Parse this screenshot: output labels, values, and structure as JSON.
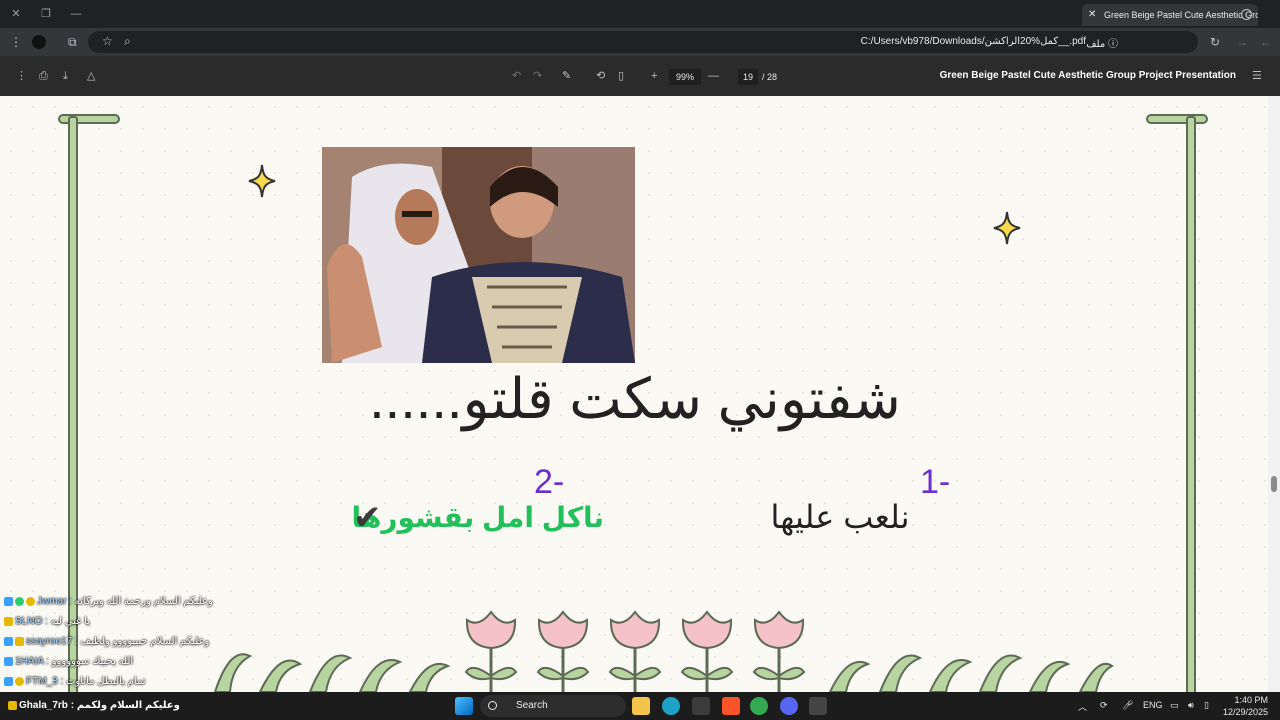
{
  "browser": {
    "tab_title": "Green Beige Pastel Cute Aesthetic Group Project Presentation",
    "url": "C:/Users/vb978/Downloads/كمل%20الراكشن__.pdf",
    "url_chip": "ملف"
  },
  "pdf_toolbar": {
    "zoom": "99%",
    "current_page": "19",
    "total_pages": "/ 28",
    "document_title": "Green Beige Pastel Cute Aesthetic Group Project Presentation"
  },
  "slide": {
    "heading": "شفتوني سكت قلتو......",
    "option1_number": "1-",
    "option1_text": "نلعب عليها",
    "option2_number": "2-",
    "option2_text": "ناكل امل بقشورها",
    "check_mark": "✔",
    "colors": {
      "number": "#6b2fd1",
      "option2": "#22c05a",
      "pole": "#b8d4a0"
    }
  },
  "chat": [
    {
      "user": "Jwmar",
      "message": "وعليكم السلام ورحمة الله وبركاته"
    },
    {
      "user": "SLNO",
      "message": "يا غبي ليه"
    },
    {
      "user": "ssayroo17",
      "message": "وعليكم السلام حبيبوووو ولطيف"
    },
    {
      "user": "1HAIA",
      "message": "الله يحييك سوووووو"
    },
    {
      "user": "FTM_3",
      "message": "تمام يالبطل ماتاوت"
    }
  ],
  "stream_overlay": {
    "name": "Ghala_7rb",
    "message": ": وعليكم السلام ولكمم"
  },
  "taskbar": {
    "search_label": "Search",
    "language": "ENG",
    "time": "1:40 PM",
    "date": "12/29/2025"
  }
}
